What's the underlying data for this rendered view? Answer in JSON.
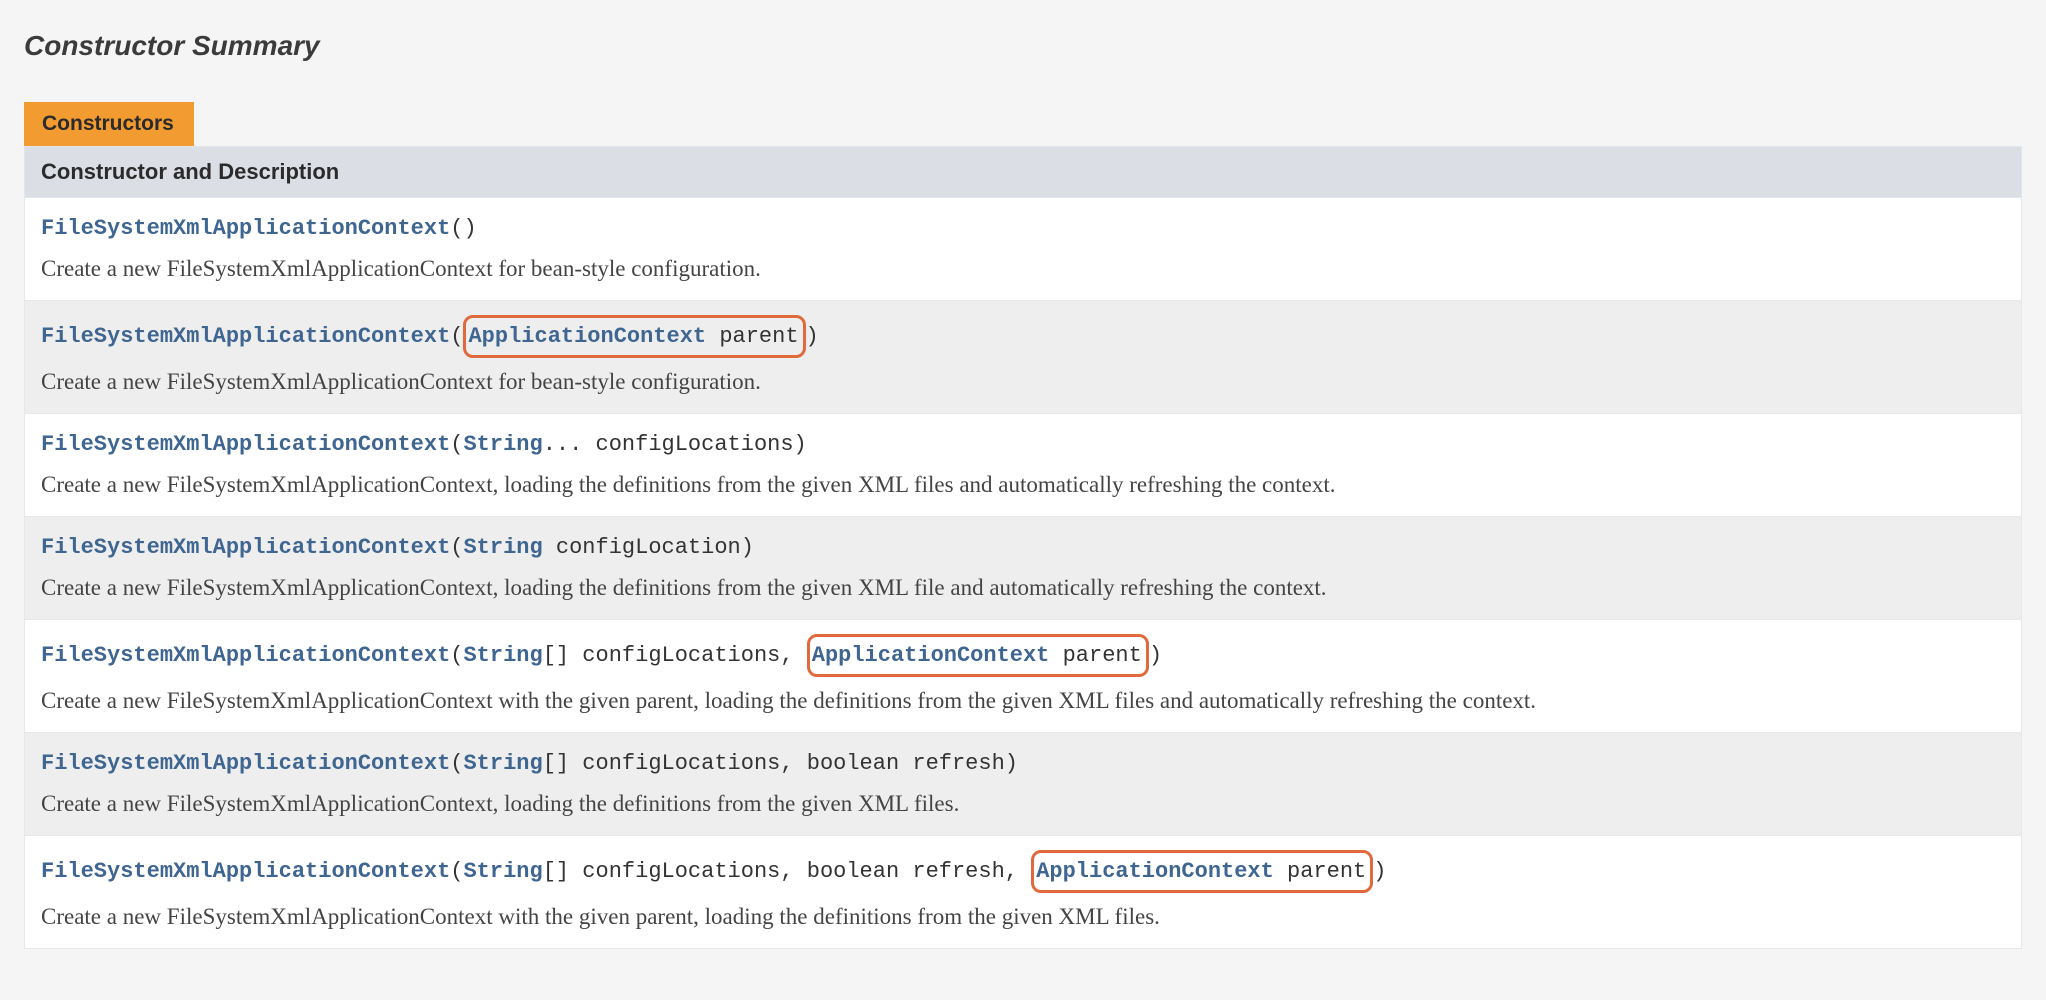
{
  "section_title": "Constructor Summary",
  "tab_label": "Constructors",
  "column_header": "Constructor and Description",
  "class_name": "FileSystemXmlApplicationContext",
  "rows": [
    {
      "sig_segments": [
        {
          "t": "()",
          "kind": "plain",
          "hl": false
        }
      ],
      "desc": "Create a new FileSystemXmlApplicationContext for bean-style configuration."
    },
    {
      "sig_segments": [
        {
          "t": "(",
          "kind": "plain",
          "hl": false
        },
        {
          "t": "ApplicationContext",
          "kind": "link",
          "hl": true
        },
        {
          "t": " parent",
          "kind": "plain",
          "hl": true
        },
        {
          "t": ")",
          "kind": "plain",
          "hl": false
        }
      ],
      "desc": "Create a new FileSystemXmlApplicationContext for bean-style configuration."
    },
    {
      "sig_segments": [
        {
          "t": "(",
          "kind": "plain",
          "hl": false
        },
        {
          "t": "String",
          "kind": "link",
          "hl": false
        },
        {
          "t": "... configLocations)",
          "kind": "plain",
          "hl": false
        }
      ],
      "desc": "Create a new FileSystemXmlApplicationContext, loading the definitions from the given XML files and automatically refreshing the context."
    },
    {
      "sig_segments": [
        {
          "t": "(",
          "kind": "plain",
          "hl": false
        },
        {
          "t": "String",
          "kind": "link",
          "hl": false
        },
        {
          "t": " configLocation)",
          "kind": "plain",
          "hl": false
        }
      ],
      "desc": "Create a new FileSystemXmlApplicationContext, loading the definitions from the given XML file and automatically refreshing the context."
    },
    {
      "sig_segments": [
        {
          "t": "(",
          "kind": "plain",
          "hl": false
        },
        {
          "t": "String",
          "kind": "link",
          "hl": false
        },
        {
          "t": "[] configLocations, ",
          "kind": "plain",
          "hl": false
        },
        {
          "t": "ApplicationContext",
          "kind": "link",
          "hl": true
        },
        {
          "t": " parent",
          "kind": "plain",
          "hl": true
        },
        {
          "t": ")",
          "kind": "plain",
          "hl": false
        }
      ],
      "desc": "Create a new FileSystemXmlApplicationContext with the given parent, loading the definitions from the given XML files and automatically refreshing the context."
    },
    {
      "sig_segments": [
        {
          "t": "(",
          "kind": "plain",
          "hl": false
        },
        {
          "t": "String",
          "kind": "link",
          "hl": false
        },
        {
          "t": "[] configLocations, boolean refresh)",
          "kind": "plain",
          "hl": false
        }
      ],
      "desc": "Create a new FileSystemXmlApplicationContext, loading the definitions from the given XML files."
    },
    {
      "sig_segments": [
        {
          "t": "(",
          "kind": "plain",
          "hl": false
        },
        {
          "t": "String",
          "kind": "link",
          "hl": false
        },
        {
          "t": "[] configLocations, boolean refresh, ",
          "kind": "plain",
          "hl": false
        },
        {
          "t": "ApplicationContext",
          "kind": "link",
          "hl": true
        },
        {
          "t": " parent",
          "kind": "plain",
          "hl": true
        },
        {
          "t": ")",
          "kind": "plain",
          "hl": false
        }
      ],
      "desc": "Create a new FileSystemXmlApplicationContext with the given parent, loading the definitions from the given XML files."
    }
  ]
}
